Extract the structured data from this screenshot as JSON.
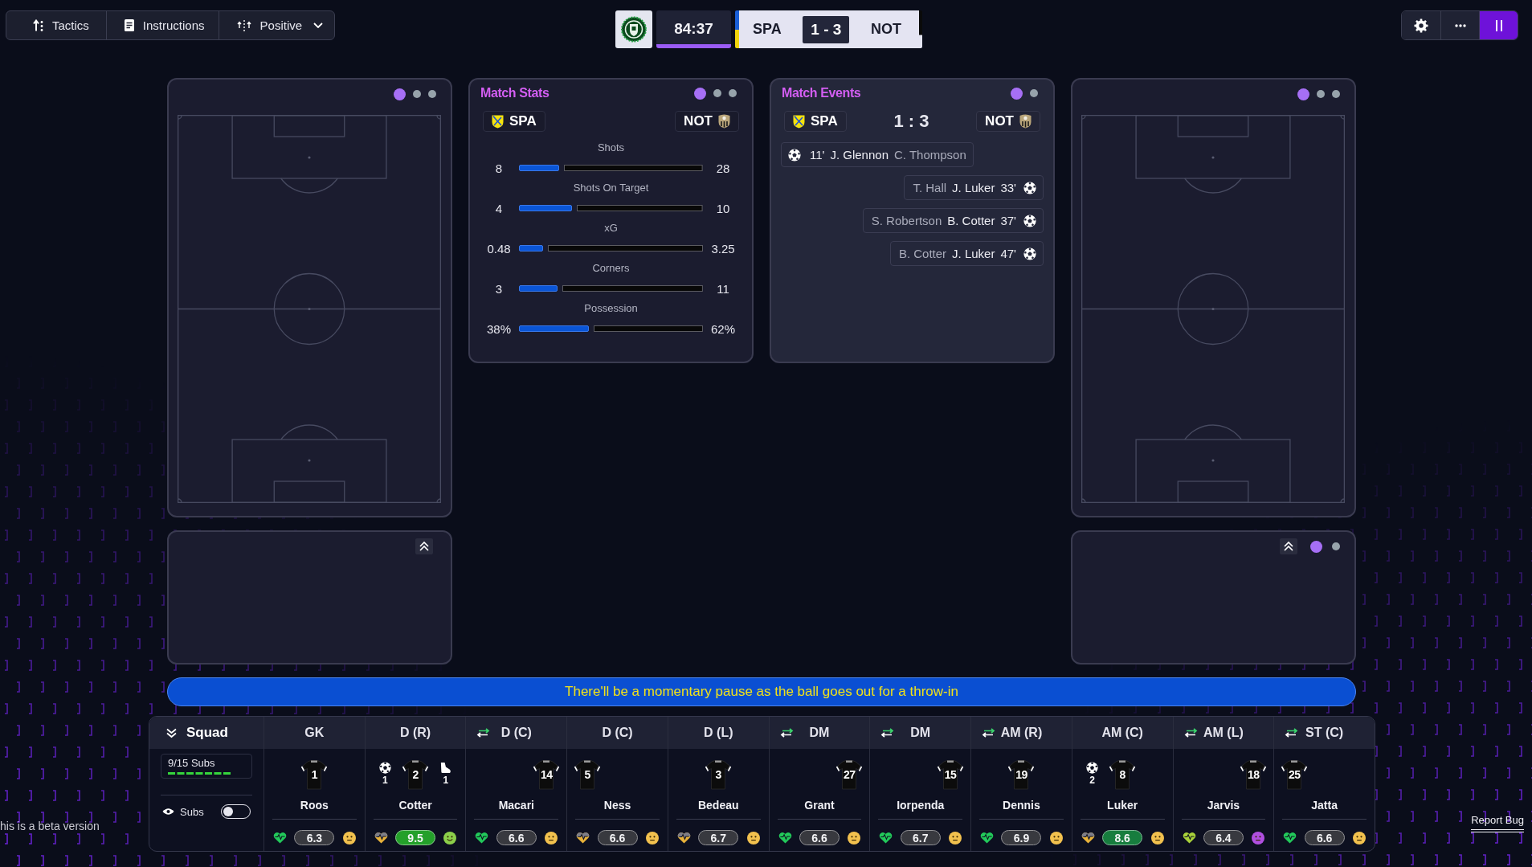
{
  "toolbar": [
    {
      "label": "Tactics",
      "kind": "button"
    },
    {
      "label": "Instructions",
      "kind": "button"
    },
    {
      "label": "Positive",
      "kind": "dropdown"
    }
  ],
  "match_header": {
    "clock": "84:37",
    "home": "SPA",
    "score": "1 - 3",
    "away": "NOT"
  },
  "top_actions": [
    {
      "kind": "settings",
      "highlighted": false
    },
    {
      "kind": "more",
      "highlighted": false
    },
    {
      "kind": "pause",
      "highlighted": true
    }
  ],
  "left_panels": {
    "pitch_dots": [
      {
        "selected": true
      },
      {
        "selected": false
      },
      {
        "selected": false
      }
    ]
  },
  "match_stats": {
    "title": "Match Stats",
    "dots": [
      {
        "selected": true
      },
      {
        "selected": false
      },
      {
        "selected": false
      }
    ],
    "home": "SPA",
    "away": "NOT",
    "stats": [
      {
        "label": "Shots",
        "home": "8",
        "away": "28",
        "level": 0.22
      },
      {
        "label": "Shots On Target",
        "home": "4",
        "away": "10",
        "level": 0.29
      },
      {
        "label": "xG",
        "home": "0.48",
        "away": "3.25",
        "level": 0.13
      },
      {
        "label": "Corners",
        "home": "3",
        "away": "11",
        "level": 0.21
      },
      {
        "label": "Possession",
        "home": "38%",
        "away": "62%",
        "level": 0.38
      }
    ]
  },
  "match_events": {
    "title": "Match Events",
    "dots": [
      {
        "selected": true
      },
      {
        "selected": false
      }
    ],
    "home": "SPA",
    "score": "1 : 3",
    "away": "NOT",
    "events": [
      {
        "kind": "home",
        "minute": "11'",
        "scorer": "J. Glennon",
        "assist": "C. Thompson"
      },
      {
        "kind": "away",
        "minute": "33'",
        "scorer": "J. Luker",
        "assist": "T. Hall"
      },
      {
        "kind": "away",
        "minute": "37'",
        "scorer": "B. Cotter",
        "assist": "S. Robertson"
      },
      {
        "kind": "away",
        "minute": "47'",
        "scorer": "J. Luker",
        "assist": "B. Cotter"
      }
    ]
  },
  "right_panels": {
    "pitch_dots": [
      {
        "selected": true
      },
      {
        "selected": false
      },
      {
        "selected": false
      }
    ],
    "lower_dots": [
      {
        "selected": true
      },
      {
        "selected": false
      }
    ]
  },
  "banner": {
    "message": "There'll be a momentary pause as the ball goes out for a throw-in"
  },
  "squad": {
    "title": "Squad",
    "subs": "9/15 Subs",
    "subs_toggle": {
      "label": "Subs",
      "on": false
    },
    "players": [
      {
        "position": "GK",
        "swap": false,
        "shirt": {
          "number": "1",
          "kind": "center"
        },
        "name": "Roos",
        "fitness": {
          "kind": "full",
          "color": "#22c95a"
        },
        "rating": {
          "text": "6.3",
          "color": "#38393f"
        },
        "morale": {
          "kind": "neutral",
          "color": "#f2c14e"
        }
      },
      {
        "position": "D (R)",
        "swap": false,
        "shirt": {
          "number": "2",
          "kind": "center"
        },
        "name": "Cotter",
        "left_stat": {
          "kind": "goal",
          "count": "1"
        },
        "right_stat": {
          "kind": "assist",
          "count": "1"
        },
        "fitness": {
          "kind": "half",
          "color": "#e8b23a"
        },
        "rating": {
          "text": "9.5",
          "color": "#24a02a"
        },
        "morale": {
          "kind": "happy",
          "color": "#8ccf4a"
        }
      },
      {
        "position": "D (C)",
        "swap": true,
        "shirt": {
          "number": "14",
          "kind": "right"
        },
        "name": "Macari",
        "fitness": {
          "kind": "full",
          "color": "#22c95a"
        },
        "rating": {
          "text": "6.6",
          "color": "#38393f"
        },
        "morale": {
          "kind": "neutral",
          "color": "#f2c14e"
        }
      },
      {
        "position": "D (C)",
        "swap": false,
        "shirt": {
          "number": "5",
          "kind": "left"
        },
        "name": "Ness",
        "fitness": {
          "kind": "half",
          "color": "#e8b23a"
        },
        "rating": {
          "text": "6.6",
          "color": "#38393f"
        },
        "morale": {
          "kind": "neutral",
          "color": "#f2c14e"
        }
      },
      {
        "position": "D (L)",
        "swap": false,
        "shirt": {
          "number": "3",
          "kind": "center"
        },
        "name": "Bedeau",
        "fitness": {
          "kind": "half",
          "color": "#e8b23a"
        },
        "rating": {
          "text": "6.7",
          "color": "#38393f"
        },
        "morale": {
          "kind": "neutral",
          "color": "#f2c14e"
        }
      },
      {
        "position": "DM",
        "swap": true,
        "shirt": {
          "number": "27",
          "kind": "right"
        },
        "name": "Grant",
        "fitness": {
          "kind": "full",
          "color": "#22c95a"
        },
        "rating": {
          "text": "6.6",
          "color": "#38393f"
        },
        "morale": {
          "kind": "neutral",
          "color": "#f2c14e"
        }
      },
      {
        "position": "DM",
        "swap": true,
        "shirt": {
          "number": "15",
          "kind": "right"
        },
        "name": "Iorpenda",
        "fitness": {
          "kind": "full",
          "color": "#22c95a"
        },
        "rating": {
          "text": "6.7",
          "color": "#38393f"
        },
        "morale": {
          "kind": "neutral",
          "color": "#f2c14e"
        }
      },
      {
        "position": "AM (R)",
        "swap": true,
        "shirt": {
          "number": "19",
          "kind": "center"
        },
        "name": "Dennis",
        "fitness": {
          "kind": "full",
          "color": "#22c95a"
        },
        "rating": {
          "text": "6.9",
          "color": "#38393f"
        },
        "morale": {
          "kind": "neutral",
          "color": "#f2c14e"
        }
      },
      {
        "position": "AM (C)",
        "swap": false,
        "shirt": {
          "number": "8",
          "kind": "center"
        },
        "name": "Luker",
        "left_stat": {
          "kind": "goal",
          "count": "2"
        },
        "fitness": {
          "kind": "half",
          "color": "#e8b23a"
        },
        "rating": {
          "text": "8.6",
          "color": "#177d3e"
        },
        "morale": {
          "kind": "neutral",
          "color": "#f2c14e"
        }
      },
      {
        "position": "AM (L)",
        "swap": true,
        "shirt": {
          "number": "18",
          "kind": "right"
        },
        "name": "Jarvis",
        "fitness": {
          "kind": "full",
          "color": "#a9d23a"
        },
        "rating": {
          "text": "6.4",
          "color": "#38393f"
        },
        "morale": {
          "kind": "neutral",
          "color": "#b04fe0"
        }
      },
      {
        "position": "ST (C)",
        "swap": true,
        "shirt": {
          "number": "25",
          "kind": "left"
        },
        "name": "Jatta",
        "fitness": {
          "kind": "full",
          "color": "#22c95a"
        },
        "rating": {
          "text": "6.6",
          "color": "#38393f"
        },
        "morale": {
          "kind": "neutral",
          "color": "#f2c14e"
        }
      }
    ]
  },
  "footer": {
    "version_note": "his is a beta version",
    "report": "Report Bug"
  }
}
